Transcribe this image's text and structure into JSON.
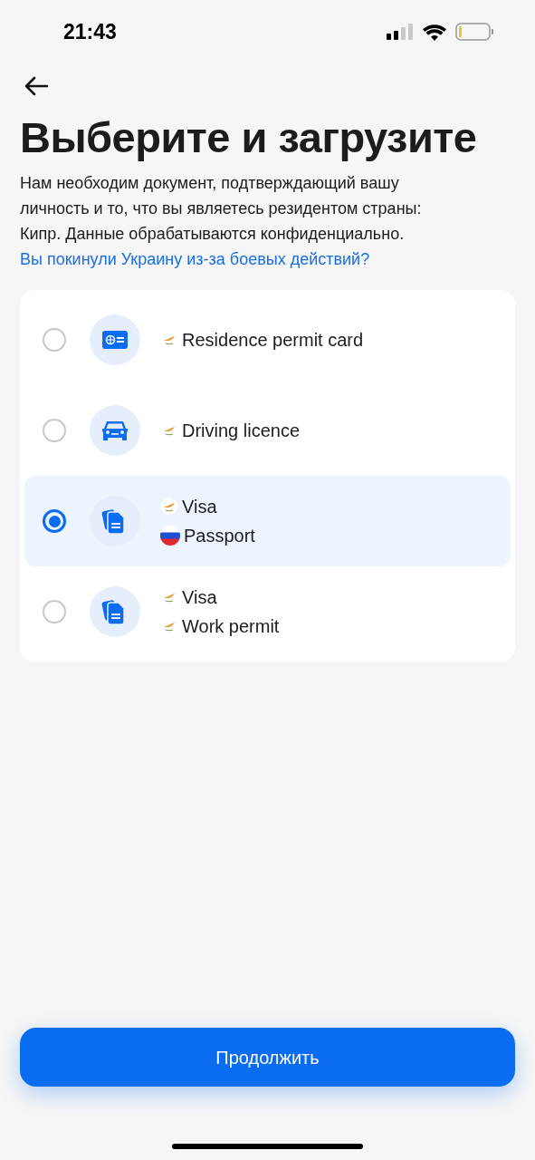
{
  "status_bar": {
    "time": "21:43"
  },
  "title": "Выберите и загрузите",
  "description": "Нам необходим документ, подтверждающий вашу личность и то, что вы являетесь резидентом страны: Кипр. Данные обрабатываются конфиденциально.",
  "link": "Вы покинули Украину из-за боевых действий?",
  "options": [
    {
      "kind": "id-card",
      "selected": false,
      "documents": [
        {
          "kind": "cyprus",
          "label": "Residence permit card"
        }
      ]
    },
    {
      "kind": "car",
      "selected": false,
      "documents": [
        {
          "kind": "cyprus",
          "label": "Driving licence"
        }
      ]
    },
    {
      "kind": "papers",
      "selected": true,
      "documents": [
        {
          "kind": "cyprus",
          "label": "Visa"
        },
        {
          "kind": "russia",
          "label": "Passport"
        }
      ]
    },
    {
      "kind": "papers",
      "selected": false,
      "documents": [
        {
          "kind": "cyprus",
          "label": "Visa"
        },
        {
          "kind": "cyprus",
          "label": "Work permit"
        }
      ]
    }
  ],
  "continue_button": "Продолжить"
}
